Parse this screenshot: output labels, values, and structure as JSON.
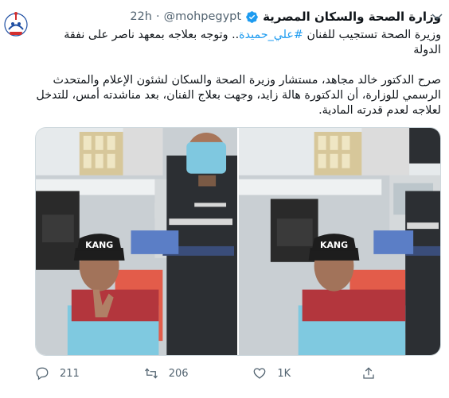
{
  "account": {
    "display_name": "وزارة الصحة والسكان المصرية",
    "handle": "@mohpegypt",
    "separator": "·",
    "time": "22h",
    "verified": true
  },
  "tweet": {
    "line1_prefix": "وزيرة الصحة تستجيب للفنان ",
    "hashtag": "#علي_حميدة",
    "line1_suffix": ".. وتوجه بعلاجه بمعهد ناصر على نفقة الدولة",
    "paragraph2": "صرح الدكتور خالد مجاهد، مستشار وزيرة الصحة والسكان لشئون الإعلام والمتحدث الرسمي للوزارة، أن الدكتورة هالة زايد، وجهت بعلاج الفنان، بعد مناشدته أمس، للتدخل لعلاجه لعدم قدرته المادية."
  },
  "media": {
    "photos": [
      {
        "cap_text": "KANG"
      },
      {
        "cap_text": "KANG"
      }
    ]
  },
  "actions": {
    "reply_count": "211",
    "retweet_count": "206",
    "like_count": "1K"
  },
  "icons": {
    "verified": "verified-badge-icon",
    "caret": "chevron-down-icon",
    "reply": "reply-icon",
    "retweet": "retweet-icon",
    "like": "heart-icon",
    "share": "share-icon"
  },
  "colors": {
    "accent": "#1d9bf0",
    "muted": "#536471",
    "text": "#0f1419",
    "logo_blue": "#1f4fa3",
    "logo_red": "#d32f2f"
  }
}
